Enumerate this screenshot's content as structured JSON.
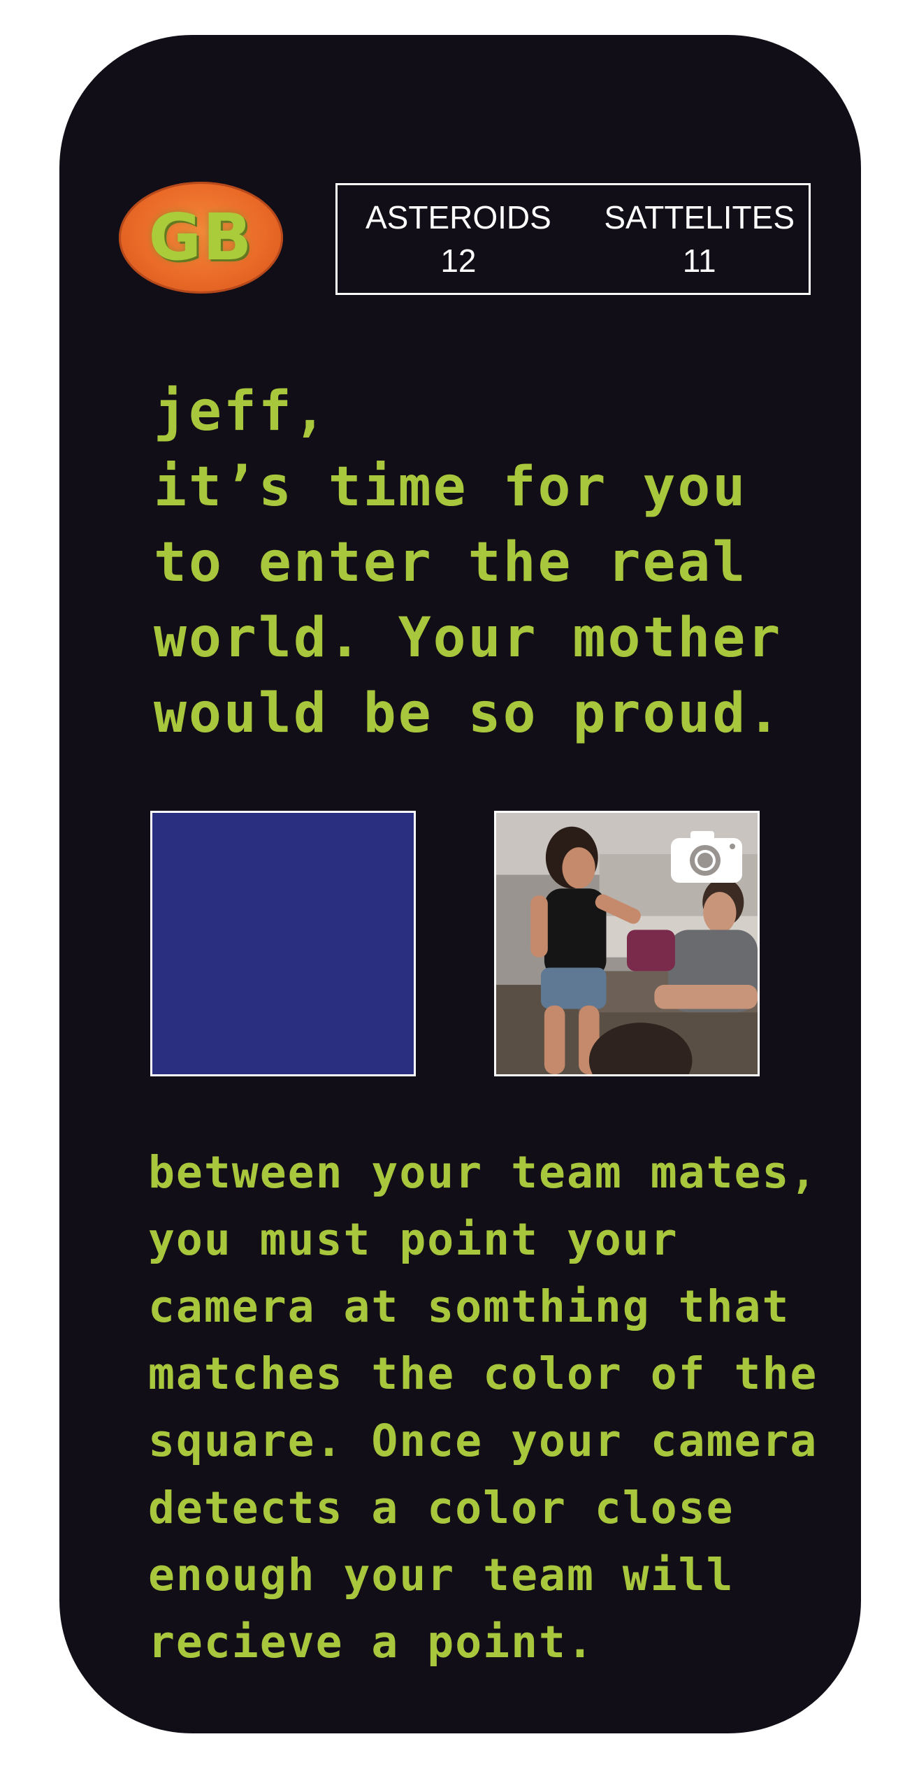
{
  "logo": {
    "text": "GB"
  },
  "scoreboard": {
    "teams": [
      {
        "name": "ASTEROIDS",
        "score": "12"
      },
      {
        "name": "SATTELITES",
        "score": "11"
      }
    ]
  },
  "message": {
    "greeting": "jeff,\nit’s time for you\nto enter the real\nworld. Your mother\nwould be so proud."
  },
  "target_color": {
    "hex": "#2a2f80"
  },
  "camera": {
    "icon": "camera-icon"
  },
  "instructions": {
    "text": "between your team mates,\nyou must point your\ncamera at somthing that\nmatches the color of the\nsquare. Once your camera\ndetects a color close\nenough your team will\nrecieve a point."
  },
  "colors": {
    "background": "#120e17",
    "accent_text": "#a9c73c",
    "logo_orange": "#ea6a28"
  }
}
